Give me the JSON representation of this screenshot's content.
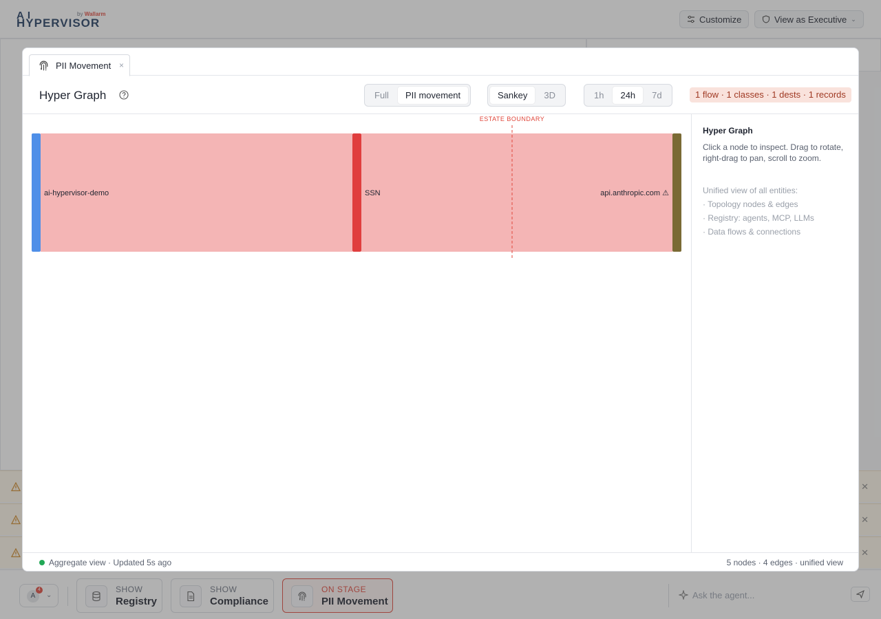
{
  "app": {
    "logo_line1": "AI",
    "logo_line2": "HYPERVISOR",
    "logo_by": "by",
    "logo_brand": "Wallarm",
    "customize_label": "Customize",
    "view_as_label": "View as Executive"
  },
  "modal": {
    "tab_label": "PII Movement",
    "title": "Hyper Graph",
    "scope_options": [
      "Full",
      "PII movement"
    ],
    "scope_selected": "PII movement",
    "view_options": [
      "Sankey",
      "3D"
    ],
    "view_selected": "Sankey",
    "time_options": [
      "1h",
      "24h",
      "7d"
    ],
    "time_selected": "24h",
    "stats_pill": "1 flow · 1 classes · 1 dests · 1 records"
  },
  "sankey": {
    "boundary_label": "ESTATE BOUNDARY",
    "nodes": [
      {
        "name": "ai-hypervisor-demo",
        "color": "#4f8fe8",
        "column": 0
      },
      {
        "name": "SSN",
        "color": "#e03e3e",
        "column": 1
      },
      {
        "name": "api.anthropic.com ⚠",
        "color": "#7a6a34",
        "column": 2
      }
    ],
    "links": [
      {
        "source": 0,
        "target": 1,
        "value": 1,
        "color": "#f4b5b5"
      },
      {
        "source": 1,
        "target": 2,
        "value": 1,
        "color": "#f4b5b5"
      }
    ]
  },
  "side": {
    "heading": "Hyper Graph",
    "description": "Click a node to inspect. Drag to rotate, right-drag to pan, scroll to zoom.",
    "unified_label": "Unified view of all entities:",
    "items": [
      "· Topology nodes & edges",
      "· Registry: agents, MCP, LLMs",
      "· Data flows & connections"
    ]
  },
  "footer": {
    "status": "Aggregate view · Updated 5s ago",
    "summary": "5 nodes · 4 edges · unified view"
  },
  "dock": {
    "avatar_initial": "A",
    "avatar_badge": "4",
    "cards": [
      {
        "kicker": "SHOW",
        "label": "Registry",
        "icon": "database-icon"
      },
      {
        "kicker": "SHOW",
        "label": "Compliance",
        "icon": "document-icon"
      },
      {
        "kicker": "ON STAGE",
        "label": "PII Movement",
        "icon": "fingerprint-icon"
      }
    ],
    "ask_placeholder": "Ask the agent..."
  },
  "colors": {
    "accent_red": "#e0463a",
    "status_green": "#22a856",
    "link_fill": "#f4b5b5"
  }
}
